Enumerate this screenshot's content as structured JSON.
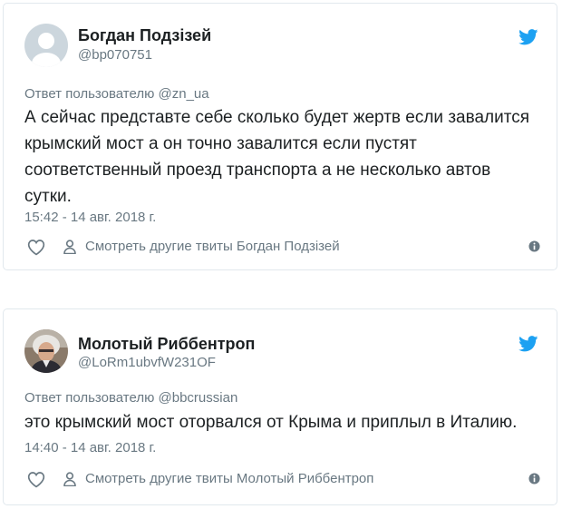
{
  "tweets": [
    {
      "display_name": "Богдан Подзізей",
      "handle": "@bp070751",
      "reply_label": "Ответ пользователю",
      "reply_to": "@zn_ua",
      "text": "А сейчас представте себе сколько будет жертв если завалится крымский мост а он точно завалится если пустят соответственный проезд транспорта а не несколько автов сутки.",
      "timestamp": "15:42 - 14 авг. 2018 г.",
      "more_tweets_label": "Смотреть другие твиты Богдан Подзізей",
      "avatar_icon": "default-avatar-icon"
    },
    {
      "display_name": "Молотый Риббентроп",
      "handle": "@LoRm1ubvfW231OF",
      "reply_label": "Ответ пользователю",
      "reply_to": "@bbcrussian",
      "text": "это крымский мост оторвался от Крыма и приплыл в Италию.",
      "timestamp": "14:40 - 14 авг. 2018 г.",
      "more_tweets_label": "Смотреть другие твиты Молотый Риббентроп",
      "avatar_icon": "profile-photo"
    }
  ],
  "colors": {
    "twitter_blue": "#1da1f2",
    "muted_text": "#697882",
    "body_text": "#1c2022",
    "border": "#e1e8ed"
  }
}
